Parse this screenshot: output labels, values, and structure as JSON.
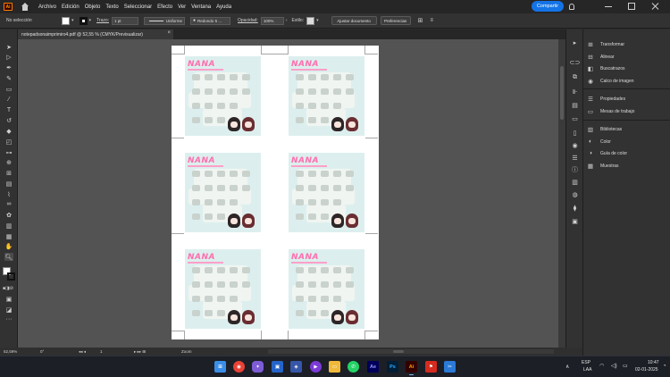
{
  "app": {
    "logo": "Ai",
    "menus": [
      "Archivo",
      "Edición",
      "Objeto",
      "Texto",
      "Seleccionar",
      "Efecto",
      "Ver",
      "Ventana",
      "Ayuda"
    ],
    "share_label": "Compartir",
    "accent_color": "#1473e6"
  },
  "controlbar": {
    "selection": "No selección",
    "stroke_label": "Trazo:",
    "stroke_value": "1 pt",
    "stroke_profile": "Uniforme",
    "brush_value": "Redondo 5 ...",
    "opacity_label": "Opacidad:",
    "opacity_value": "100%",
    "style_label": "Estilo:",
    "align_doc": "Ajustar documento",
    "prefs": "Preferencias"
  },
  "document": {
    "tab_title": "notepadsonaimprimiro4.pdf @ 52,55 % (CMYK/Previsualizar)",
    "artwork_text": "NANA"
  },
  "tools": [
    "selection-tool",
    "direct-selection-tool",
    "pen-tool",
    "curvature-tool",
    "rectangle-tool",
    "paintbrush-tool",
    "pencil-tool",
    "type-tool",
    "rotate-tool",
    "eraser-tool",
    "scale-tool",
    "width-tool",
    "shape-builder-tool",
    "perspective-tool",
    "mesh-tool",
    "gradient-tool",
    "eyedropper-tool",
    "blend-tool",
    "symbol-sprayer-tool",
    "column-graph-tool",
    "artboard-tool",
    "slice-tool",
    "hand-tool",
    "zoom-tool"
  ],
  "right_panels": {
    "group1": [
      "Transformar",
      "Alinear",
      "Buscatrazos",
      "Calco de imagen"
    ],
    "group2": [
      "Propiedades",
      "Mesas de trabajo"
    ],
    "group3": [
      "Bibliotecas",
      "Color",
      "Guía de color",
      "Muestras"
    ]
  },
  "statusbar": {
    "zoom": "52,59%",
    "rotation": "0°",
    "artboard_number": "1",
    "tool_name": "Zoom"
  },
  "taskbar": {
    "language": "ESP",
    "layout": "LAA",
    "time": "10:47",
    "date": "02-01-2025",
    "apps": [
      "windows-start-icon",
      "chrome-icon",
      "copilot-icon",
      "store-icon",
      "media-player-icon",
      "explorer-icon",
      "whatsapp-icon",
      "after-effects-icon",
      "photoshop-icon",
      "illustrator-icon",
      "acrobat-icon",
      "snipping-tool-icon"
    ],
    "app_labels": {
      "ae": "Ae",
      "ps": "Ps",
      "ai": "Ai"
    }
  }
}
